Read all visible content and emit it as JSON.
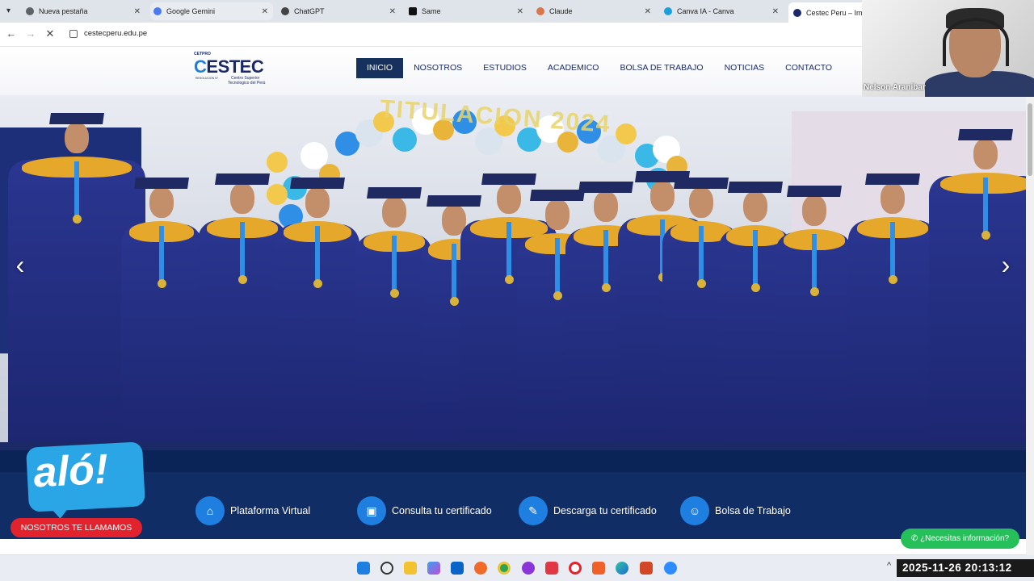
{
  "browser": {
    "tabs": [
      {
        "title": "Nueva pestaña",
        "fav_color": "#5f6368"
      },
      {
        "title": "Google Gemini",
        "fav_color": "#4a7cf0"
      },
      {
        "title": "ChatGPT",
        "fav_color": "#444444"
      },
      {
        "title": "Same",
        "fav_color": "#111111"
      },
      {
        "title": "Claude",
        "fav_color": "#d9774b"
      },
      {
        "title": "Canva IA - Canva",
        "fav_color": "#1aa2d8"
      },
      {
        "title": "Cestec Peru – Impul",
        "fav_color": "#1b2a66"
      }
    ],
    "url": "cestecperu.edu.pe"
  },
  "site": {
    "logo": {
      "top": "CETPRO",
      "mark_e": "C",
      "mark_rest": "ESTEC",
      "sub1": "Centro Superior",
      "sub2": "Tecnologico del Perú",
      "tiny": "RESOLUCION N°"
    },
    "menu": [
      "INICIO",
      "NOSOTROS",
      "ESTUDIOS",
      "ACADEMICO",
      "BOLSA DE TRABAJO",
      "NOTICIAS",
      "CONTACTO"
    ],
    "hero_banner": "TITULACION 2024",
    "quick_links": [
      {
        "label": "Plataforma Virtual",
        "icon": "graduation-icon"
      },
      {
        "label": "Consulta tu certificado",
        "icon": "certificate-search-icon"
      },
      {
        "label": "Descarga tu certificado",
        "icon": "diploma-icon"
      },
      {
        "label": "Bolsa de Trabajo",
        "icon": "team-icon"
      }
    ],
    "alo": "aló!",
    "call_button": "NOSOTROS TE LLAMAMOS",
    "whatsapp_button": "¿Necesitas información?"
  },
  "webcam": {
    "name": "Nelson Aranibar"
  },
  "taskbar": {
    "clock": "2025-11-26  20:13:12"
  },
  "colors": {
    "navy": "#1b2a66",
    "accent": "#1f7fe0",
    "call_red": "#e2232e",
    "whatsapp": "#25c05a"
  }
}
